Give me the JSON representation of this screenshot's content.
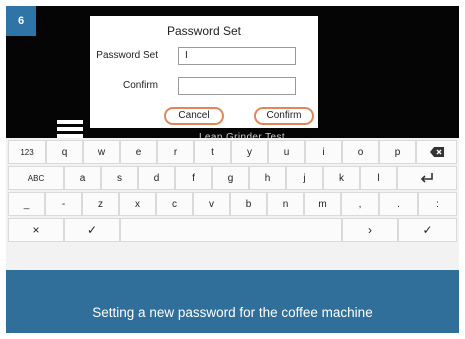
{
  "step_number": "6",
  "dialog": {
    "title": "Password Set",
    "password_label": "Password Set",
    "password_value": "I",
    "confirm_label": "Confirm",
    "confirm_value": "",
    "cancel_button": "Cancel",
    "confirm_button": "Confirm"
  },
  "background_screen": {
    "title_partial": "Lean Grinder Test"
  },
  "keyboard": {
    "row1": [
      "123",
      "q",
      "w",
      "e",
      "r",
      "t",
      "y",
      "u",
      "i",
      "o",
      "p"
    ],
    "row2": [
      "ABC",
      "a",
      "s",
      "d",
      "f",
      "g",
      "h",
      "j",
      "k",
      "l"
    ],
    "row3": [
      "_",
      "-",
      "z",
      "x",
      "c",
      "v",
      "b",
      "n",
      "m",
      ",",
      ".",
      ":"
    ],
    "row4": [
      "×",
      "✓",
      "",
      "›",
      "✓"
    ],
    "backspace_icon": "backspace-icon",
    "enter_icon": "enter-icon"
  },
  "caption": "Setting a new password for the coffee machine"
}
